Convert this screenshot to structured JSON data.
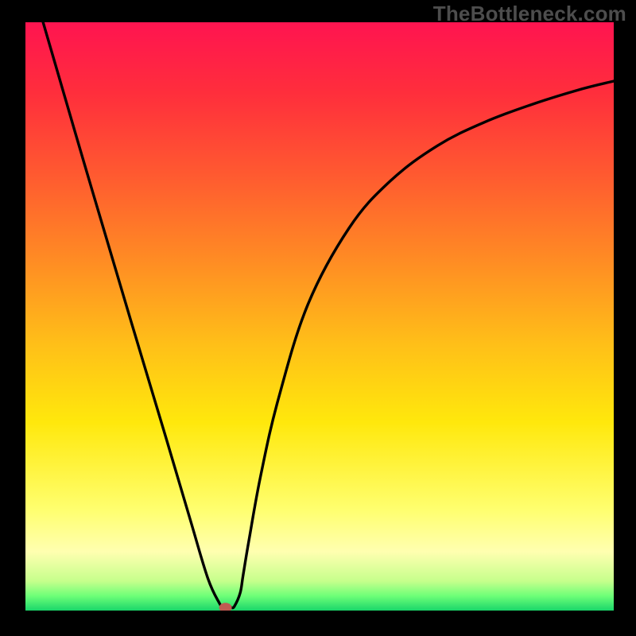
{
  "watermark": "TheBottleneck.com",
  "chart_data": {
    "type": "line",
    "title": "",
    "xlabel": "",
    "ylabel": "",
    "xlim": [
      0,
      100
    ],
    "ylim": [
      0,
      100
    ],
    "grid": false,
    "legend": false,
    "series": [
      {
        "name": "curve",
        "x": [
          3,
          10,
          18,
          24,
          28,
          31,
          33,
          33.5,
          34,
          34.5,
          35,
          35.5,
          36.5,
          37,
          38,
          40,
          43,
          48,
          55,
          62,
          70,
          78,
          86,
          94,
          100
        ],
        "y": [
          100,
          76,
          49,
          29,
          15.5,
          5.5,
          1.2,
          0.7,
          0.5,
          0.5,
          0.5,
          0.7,
          3,
          6,
          12,
          23,
          36,
          52,
          65,
          73,
          79,
          83,
          86,
          88.5,
          90
        ]
      }
    ],
    "background_gradient": {
      "stops": [
        [
          0.0,
          "#FF1450"
        ],
        [
          0.12,
          "#FF2E3C"
        ],
        [
          0.26,
          "#FF5A30"
        ],
        [
          0.4,
          "#FF8A24"
        ],
        [
          0.55,
          "#FFC018"
        ],
        [
          0.68,
          "#FFE80C"
        ],
        [
          0.83,
          "#FFFF70"
        ],
        [
          0.9,
          "#FFFFB0"
        ],
        [
          0.95,
          "#C6FF8C"
        ],
        [
          0.975,
          "#6EFF78"
        ],
        [
          1.0,
          "#1AD66A"
        ]
      ]
    },
    "marker": {
      "x": 34,
      "y": 0.5,
      "color": "#C05A52",
      "rx": 8,
      "ry": 6
    }
  }
}
